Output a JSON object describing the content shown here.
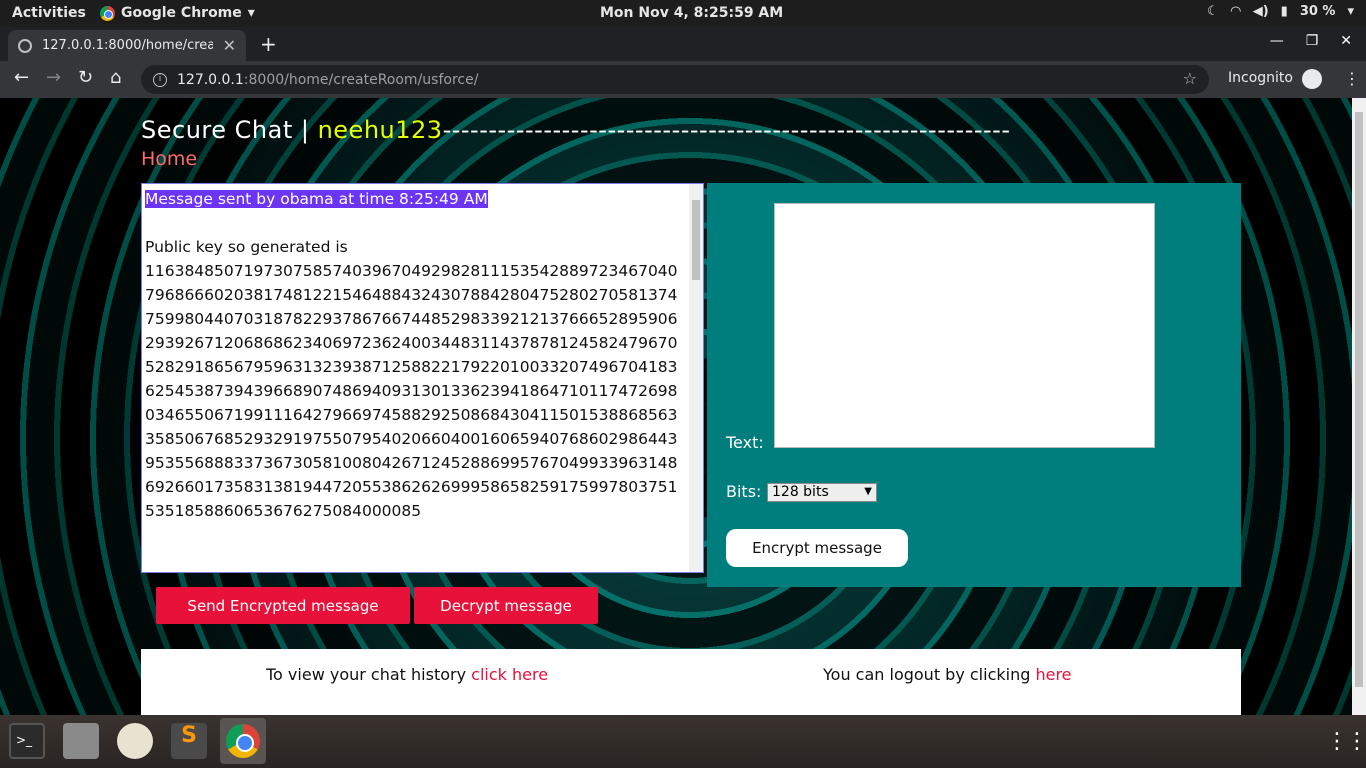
{
  "topbar": {
    "activities": "Activities",
    "app_name": "Google Chrome",
    "clock": "Mon Nov  4,  8:25:59 AM",
    "battery": "30 %"
  },
  "browser": {
    "tab_title": "127.0.0.1:8000/home/crea",
    "url_host": "127.0.0.1",
    "url_path": ":8000/home/createRoom/usforce/",
    "incognito_label": "Incognito"
  },
  "header": {
    "site_name": "Secure Chat | ",
    "username": "neehu123",
    "dashes": "--------------------------------------------------------------",
    "home_link": "Home"
  },
  "message_box": {
    "highlight_line": "Message sent by obama at time 8:25:49 AM",
    "key_label": "Public key so generated is",
    "key_digits": "1163848507197307585740396704929828111535428897234670407968666020381748122154648843243078842804752802705813747599804407031878229378676674485298339212137666528959062939267120686862340697236240034483114378781245824796705282918656795963132393871258822179220100332074967041836254538739439668907486940931301336239418647101174726980346550671991116427966974588292508684304115015388685633585067685293291975507954020660400160659407686029864439535568883373673058100804267124528869957670499339631486926601735831381944720553862626999586582591759978037515351858860653676275084000085"
  },
  "panel": {
    "text_label": "Text:",
    "bits_label": "Bits:",
    "bits_selected": "128 bits",
    "encrypt_button": "Encrypt message"
  },
  "actions": {
    "send_button": "Send Encrypted message",
    "decrypt_button": "Decrypt message"
  },
  "footer": {
    "history_text": "To view your chat history ",
    "history_link": "click here",
    "logout_text": "You can logout by clicking ",
    "logout_link": "here"
  },
  "colors": {
    "panel_bg": "#007d7d",
    "button_red": "#e8113a",
    "username_yellow": "#e6ff00",
    "highlight": "#6c34f5"
  }
}
